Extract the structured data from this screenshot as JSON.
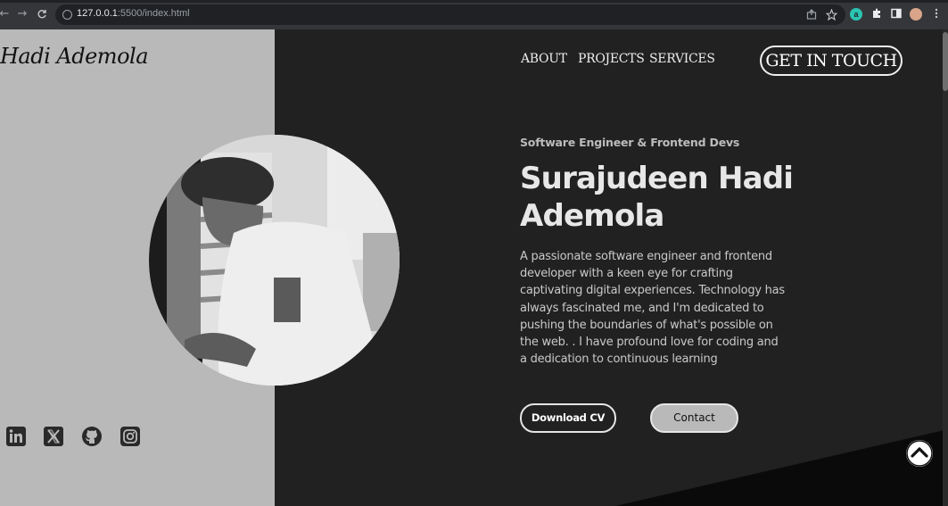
{
  "browser": {
    "back": "←",
    "forward": "→",
    "reload": "C",
    "url_host": "127.0.0.1",
    "url_rest": ":5500/index.html",
    "extensions": [
      "a"
    ]
  },
  "site": {
    "logo": "Hadi Ademola",
    "nav": [
      "ABOUT",
      "PROJECTS",
      "SERVICES"
    ],
    "cta": "GET IN TOUCH"
  },
  "hero": {
    "eyebrow": "Software Engineer & Frontend Devs",
    "name_line1": "Surajudeen Hadi",
    "name_line2": "Ademola",
    "bio": "A passionate software engineer and frontend developer with a keen eye for crafting captivating digital experiences. Technology has always fascinated me, and I'm dedicated to pushing the boundaries of what's possible on the web. . I have profound love for coding and a dedication to continuous learning",
    "download_cv": "Download CV",
    "contact": "Contact"
  },
  "social": [
    "linkedin-icon",
    "x-twitter-icon",
    "github-icon",
    "instagram-icon"
  ],
  "colors": {
    "dark_bg": "#212121",
    "left_panel": "#b9b9b9",
    "text_light": "#e7e7e7"
  }
}
